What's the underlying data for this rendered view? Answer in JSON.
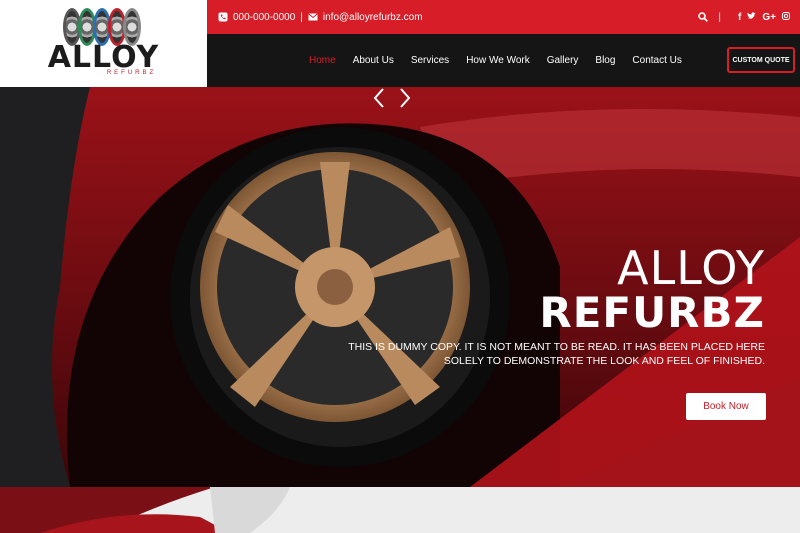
{
  "logo": {
    "title": "ALLOY",
    "subtitle": "REFURBZ"
  },
  "topbar": {
    "phone": "000-000-0000",
    "separator": "|",
    "email": "info@alloyrefurbz.com",
    "divider": "|",
    "social": [
      "f",
      "t",
      "G+",
      "ig"
    ]
  },
  "nav": {
    "items": [
      {
        "label": "Home",
        "active": true
      },
      {
        "label": "About Us"
      },
      {
        "label": "Services"
      },
      {
        "label": "How We Work"
      },
      {
        "label": "Gallery"
      },
      {
        "label": "Blog"
      },
      {
        "label": "Contact Us"
      }
    ],
    "quote_button": "CUSTOM QUOTE"
  },
  "hero": {
    "line1": "ALLOY",
    "line2": "REFURBZ",
    "description": "THIS IS DUMMY COPY. IT IS NOT MEANT TO BE READ. IT HAS BEEN PLACED HERE SOLELY TO DEMONSTRATE THE LOOK AND FEEL OF FINISHED.",
    "button": "Book Now"
  },
  "colors": {
    "accent": "#d71e28",
    "dark": "#151515",
    "bronze": "#b98a5e"
  }
}
